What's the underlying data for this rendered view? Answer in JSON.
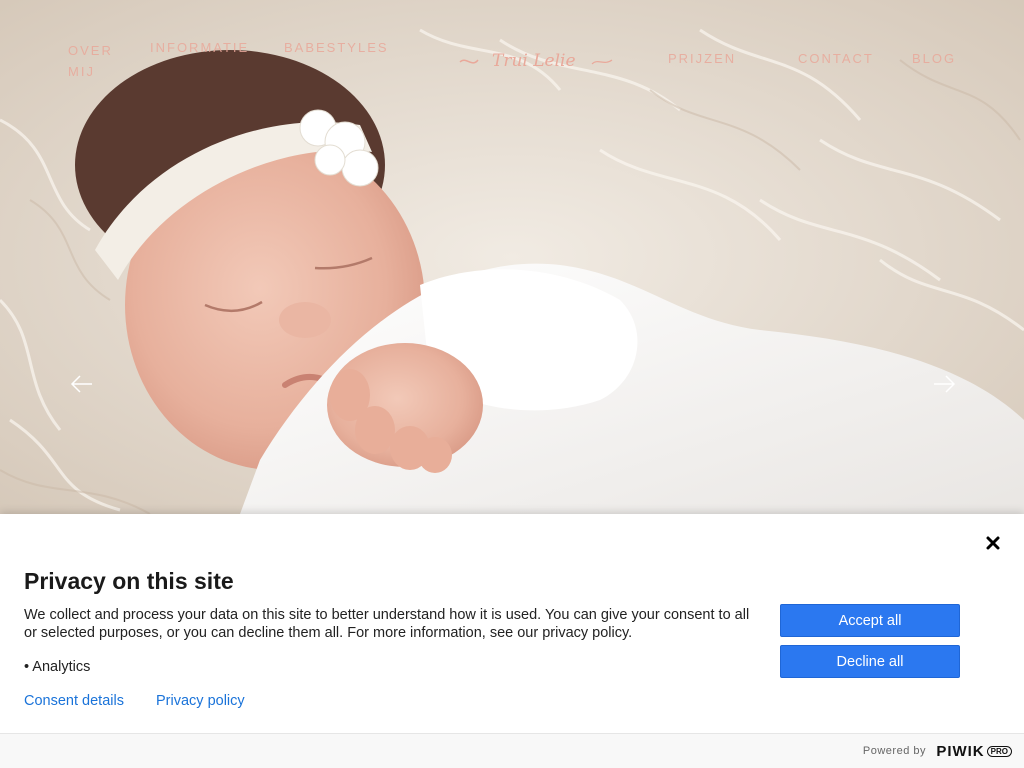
{
  "nav": {
    "left": [
      "OVER MIJ",
      "INFORMATIE",
      "BABESTYLES"
    ],
    "right": [
      "PRIJZEN",
      "CONTACT",
      "BLOG"
    ],
    "logo_text": "Trui Lelie"
  },
  "banner": {
    "title": "Privacy on this site",
    "description": "We collect and process your data on this site to better understand how it is used. You can give your consent to all or selected purposes, or you can decline them all. For more information, see our privacy policy.",
    "purpose": "• Analytics",
    "consent_details": "Consent details",
    "privacy_policy": "Privacy policy",
    "accept_all": "Accept all",
    "decline_all": "Decline all",
    "powered_by": "Powered by",
    "brand": "PIWIK",
    "brand_badge": "PRO"
  },
  "colors": {
    "button": "#2b78f0",
    "link": "#1a73d9",
    "nav": "#e9a89a"
  },
  "icons": [
    "close-icon",
    "arrow-left-icon",
    "arrow-right-icon"
  ]
}
